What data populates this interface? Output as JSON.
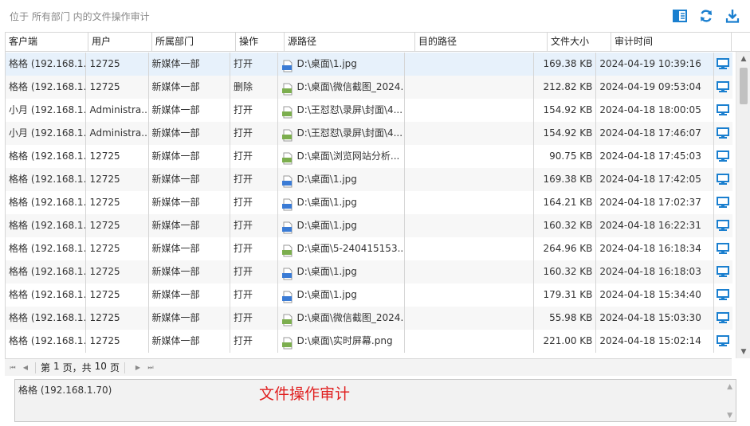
{
  "location_text": "位于 所有部门 内的文件操作审计",
  "toolbar": {
    "icons": [
      "panel-icon",
      "refresh-icon",
      "download-icon"
    ]
  },
  "columns": [
    "客户端",
    "用户",
    "所属部门",
    "操作",
    "源路径",
    "目的路径",
    "文件大小",
    "审计时间",
    ""
  ],
  "rows": [
    {
      "client": "格格 (192.168.1...",
      "user": "12725",
      "dept": "新媒体一部",
      "op": "打开",
      "src": "D:\\桌面\\1.jpg",
      "dst": "",
      "size": "169.38 KB",
      "time": "2024-04-19 10:39:16",
      "icon": "jpg"
    },
    {
      "client": "格格 (192.168.1...",
      "user": "12725",
      "dept": "新媒体一部",
      "op": "删除",
      "src": "D:\\桌面\\微信截图_2024...",
      "dst": "",
      "size": "212.82 KB",
      "time": "2024-04-19 09:53:04",
      "icon": "png"
    },
    {
      "client": "小月 (192.168.1...",
      "user": "Administra...",
      "dept": "新媒体一部",
      "op": "打开",
      "src": "D:\\王怼怼\\录屏\\封面\\4...",
      "dst": "",
      "size": "154.92 KB",
      "time": "2024-04-18 18:00:05",
      "icon": "png"
    },
    {
      "client": "小月 (192.168.1...",
      "user": "Administra...",
      "dept": "新媒体一部",
      "op": "打开",
      "src": "D:\\王怼怼\\录屏\\封面\\4...",
      "dst": "",
      "size": "154.92 KB",
      "time": "2024-04-18 17:46:07",
      "icon": "png"
    },
    {
      "client": "格格 (192.168.1...",
      "user": "12725",
      "dept": "新媒体一部",
      "op": "打开",
      "src": "D:\\桌面\\浏览网站分析...",
      "dst": "",
      "size": "90.75 KB",
      "time": "2024-04-18 17:45:03",
      "icon": "png"
    },
    {
      "client": "格格 (192.168.1...",
      "user": "12725",
      "dept": "新媒体一部",
      "op": "打开",
      "src": "D:\\桌面\\1.jpg",
      "dst": "",
      "size": "169.38 KB",
      "time": "2024-04-18 17:42:05",
      "icon": "jpg"
    },
    {
      "client": "格格 (192.168.1...",
      "user": "12725",
      "dept": "新媒体一部",
      "op": "打开",
      "src": "D:\\桌面\\1.jpg",
      "dst": "",
      "size": "164.21 KB",
      "time": "2024-04-18 17:02:37",
      "icon": "jpg"
    },
    {
      "client": "格格 (192.168.1...",
      "user": "12725",
      "dept": "新媒体一部",
      "op": "打开",
      "src": "D:\\桌面\\1.jpg",
      "dst": "",
      "size": "160.32 KB",
      "time": "2024-04-18 16:22:31",
      "icon": "jpg"
    },
    {
      "client": "格格 (192.168.1...",
      "user": "12725",
      "dept": "新媒体一部",
      "op": "打开",
      "src": "D:\\桌面\\5-240415153...",
      "dst": "",
      "size": "264.96 KB",
      "time": "2024-04-18 16:18:34",
      "icon": "png"
    },
    {
      "client": "格格 (192.168.1...",
      "user": "12725",
      "dept": "新媒体一部",
      "op": "打开",
      "src": "D:\\桌面\\1.jpg",
      "dst": "",
      "size": "160.32 KB",
      "time": "2024-04-18 16:18:03",
      "icon": "jpg"
    },
    {
      "client": "格格 (192.168.1...",
      "user": "12725",
      "dept": "新媒体一部",
      "op": "打开",
      "src": "D:\\桌面\\1.jpg",
      "dst": "",
      "size": "179.31 KB",
      "time": "2024-04-18 15:34:40",
      "icon": "jpg"
    },
    {
      "client": "格格 (192.168.1...",
      "user": "12725",
      "dept": "新媒体一部",
      "op": "打开",
      "src": "D:\\桌面\\微信截图_2024...",
      "dst": "",
      "size": "55.98 KB",
      "time": "2024-04-18 15:03:30",
      "icon": "png"
    },
    {
      "client": "格格 (192.168.1...",
      "user": "12725",
      "dept": "新媒体一部",
      "op": "打开",
      "src": "D:\\桌面\\实时屏幕.png",
      "dst": "",
      "size": "221.00 KB",
      "time": "2024-04-18 15:02:14",
      "icon": "png"
    }
  ],
  "pager": {
    "prefix": "第",
    "page": "1",
    "middle": "页，共",
    "total": "10",
    "suffix": "页"
  },
  "detail": {
    "text": "格格 (192.168.1.70)",
    "title": "文件操作审计"
  },
  "colors": {
    "accent": "#1a7fcf",
    "selected_row": "#e7f1fb",
    "title_red": "#e02020"
  }
}
